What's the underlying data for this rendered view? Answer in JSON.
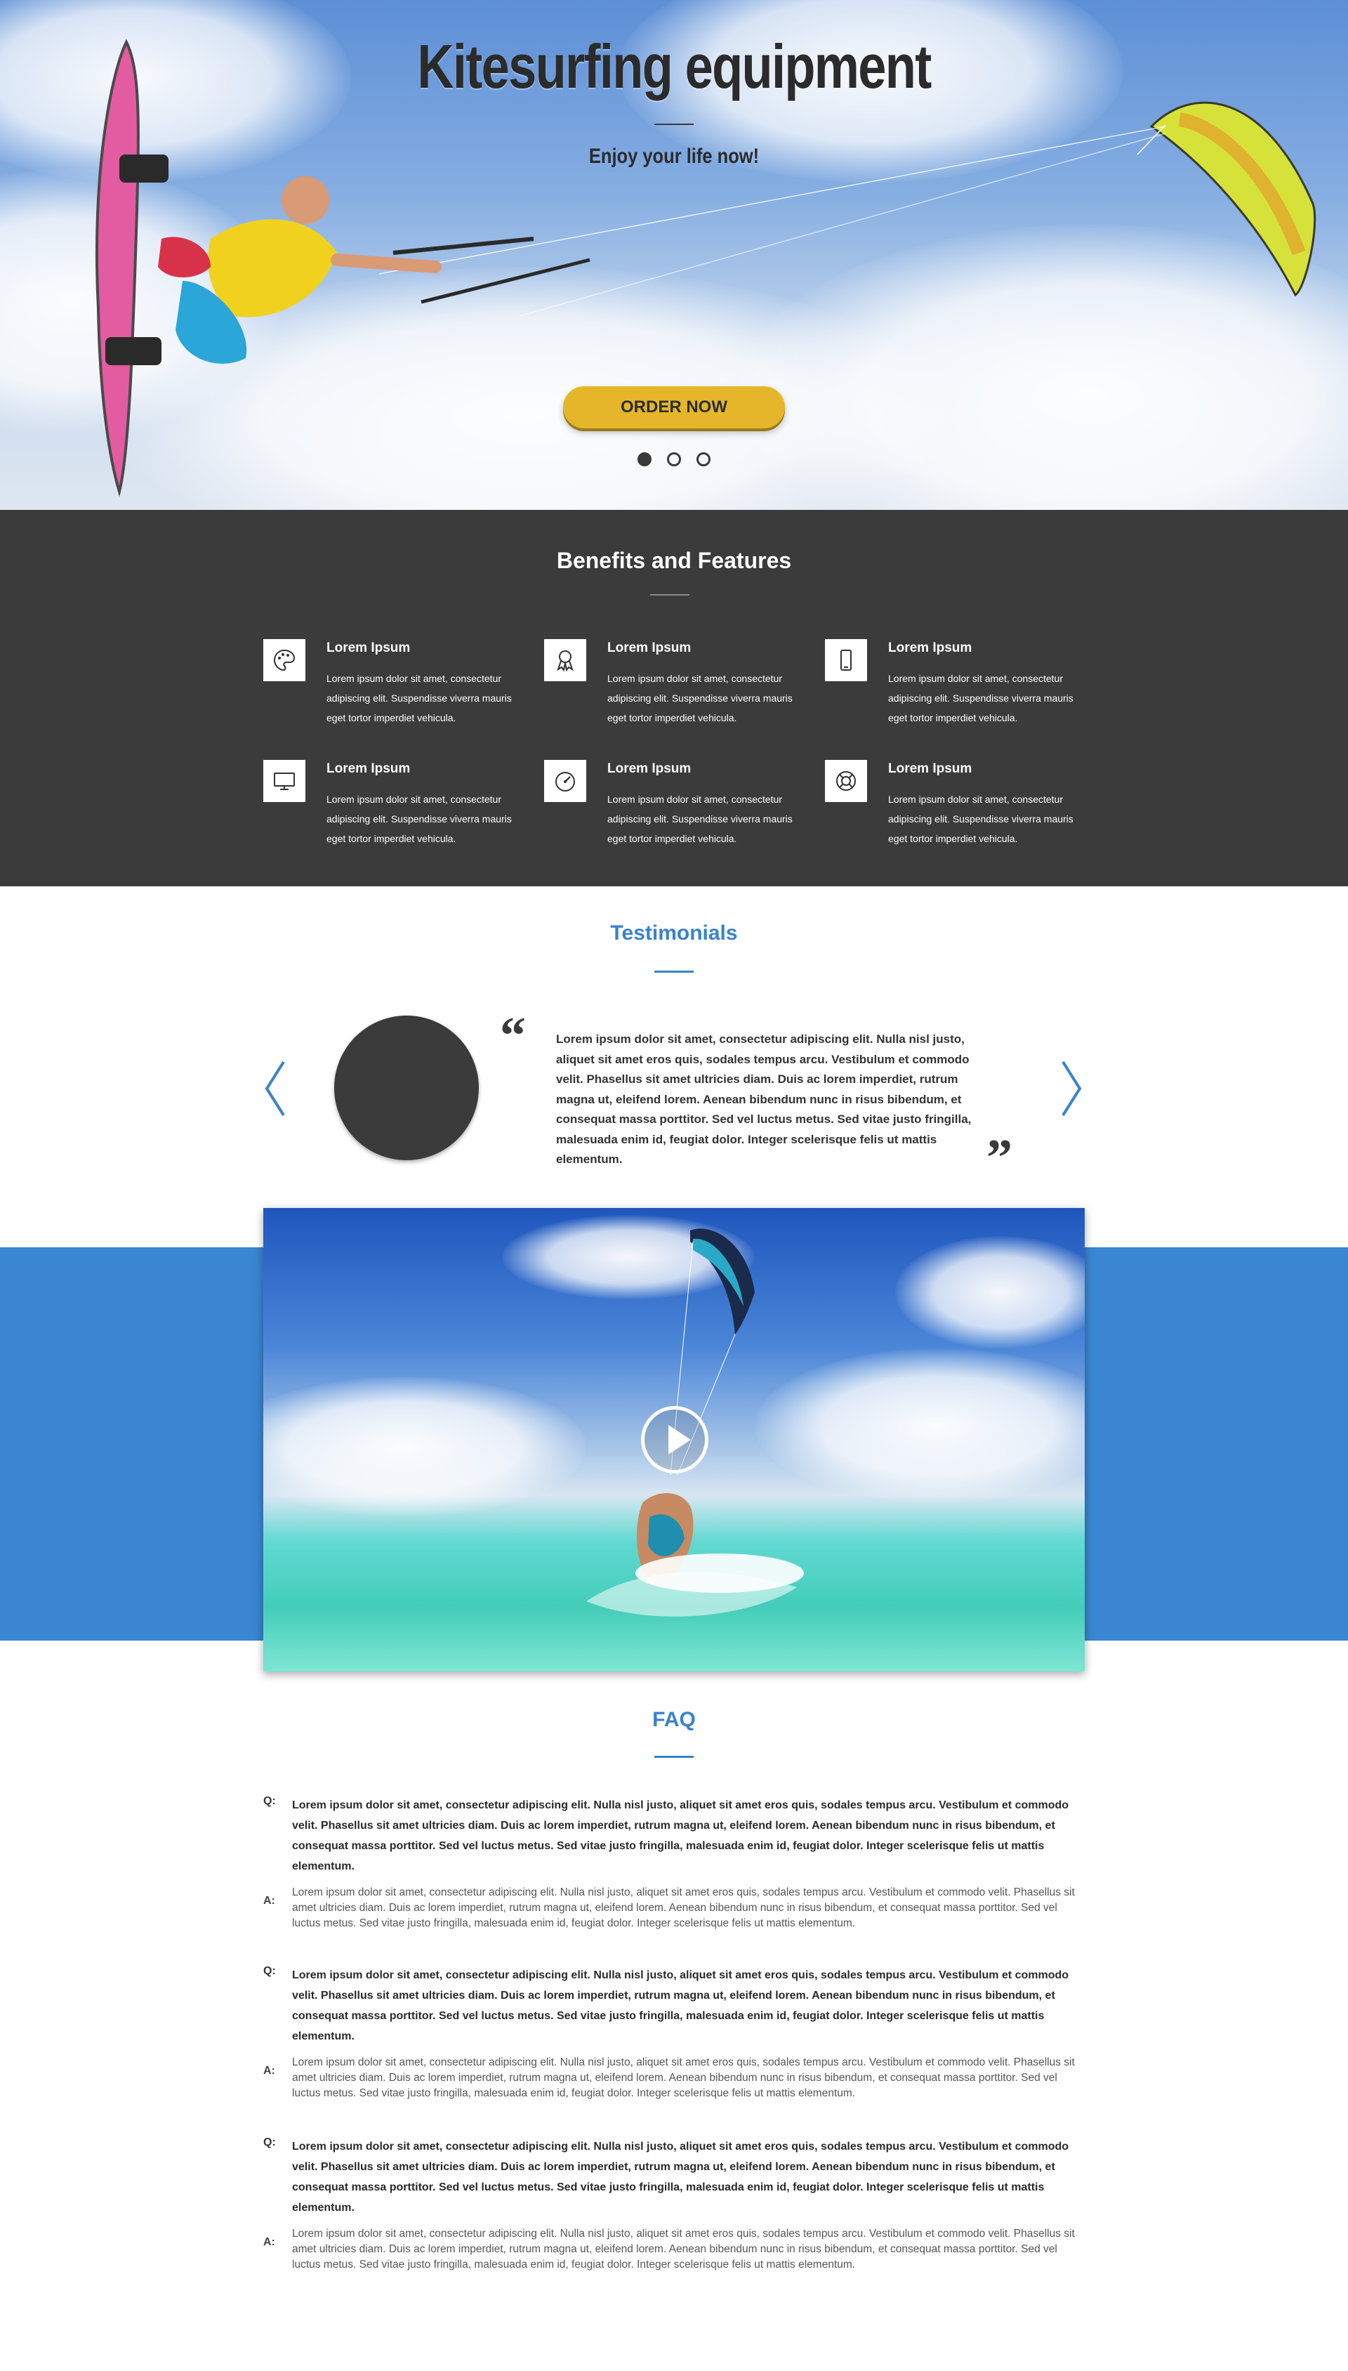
{
  "hero": {
    "title": "Kitesurfing equipment",
    "subtitle": "Enjoy your life now!",
    "cta_label": "ORDER NOW",
    "slides_count": 3,
    "active_slide": 1
  },
  "benefits": {
    "title": "Benefits and Features",
    "features": [
      {
        "icon": "palette-icon",
        "title": "Lorem Ipsum",
        "text": "Lorem ipsum dolor sit amet, consectetur adipiscing elit. Suspendisse viverra mauris eget tortor imperdiet vehicula."
      },
      {
        "icon": "award-icon",
        "title": "Lorem Ipsum",
        "text": "Lorem ipsum dolor sit amet, consectetur adipiscing elit. Suspendisse viverra mauris eget tortor imperdiet vehicula."
      },
      {
        "icon": "mobile-icon",
        "title": "Lorem Ipsum",
        "text": "Lorem ipsum dolor sit amet, consectetur adipiscing elit. Suspendisse viverra mauris eget tortor imperdiet vehicula."
      },
      {
        "icon": "monitor-icon",
        "title": "Lorem Ipsum",
        "text": "Lorem ipsum dolor sit amet, consectetur adipiscing elit. Suspendisse viverra mauris eget tortor imperdiet vehicula."
      },
      {
        "icon": "speedometer-icon",
        "title": "Lorem Ipsum",
        "text": "Lorem ipsum dolor sit amet, consectetur adipiscing elit. Suspendisse viverra mauris eget tortor imperdiet vehicula."
      },
      {
        "icon": "lifebuoy-icon",
        "title": "Lorem Ipsum",
        "text": "Lorem ipsum dolor sit amet, consectetur adipiscing elit. Suspendisse viverra mauris eget tortor imperdiet vehicula."
      }
    ]
  },
  "testimonials": {
    "title": "Testimonials",
    "quote": "Lorem ipsum dolor sit amet, consectetur adipiscing elit. Nulla nisl justo, aliquet sit amet eros quis, sodales tempus arcu. Vestibulum et commodo velit. Phasellus sit amet ultricies diam. Duis ac lorem imperdiet, rutrum magna ut, eleifend lorem. Aenean bibendum nunc in risus bibendum, et consequat massa porttitor. Sed vel luctus metus. Sed vitae justo fringilla, malesuada enim id, feugiat dolor. Integer scelerisque felis ut mattis elementum.",
    "open_quote": "“",
    "close_quote": "”"
  },
  "faq": {
    "title": "FAQ",
    "q_letter": "Q:",
    "a_letter": "A:",
    "items": [
      {
        "q": "Lorem ipsum dolor sit amet, consectetur adipiscing elit. Nulla nisl justo, aliquet sit amet eros quis, sodales tempus arcu. Vestibulum et commodo velit. Phasellus sit amet ultricies diam. Duis ac lorem imperdiet, rutrum magna ut, eleifend lorem. Aenean bibendum nunc in risus bibendum, et consequat massa porttitor. Sed vel luctus metus. Sed vitae justo fringilla, malesuada enim id, feugiat dolor. Integer scelerisque felis ut mattis elementum.",
        "a": "Lorem ipsum dolor sit amet, consectetur adipiscing elit. Nulla nisl justo, aliquet sit amet eros quis, sodales tempus arcu. Vestibulum et commodo velit. Phasellus sit amet ultricies diam. Duis ac lorem imperdiet, rutrum magna ut, eleifend lorem. Aenean bibendum nunc in risus bibendum, et consequat massa porttitor. Sed vel luctus metus. Sed vitae justo fringilla, malesuada enim id, feugiat dolor. Integer scelerisque felis ut mattis elementum."
      },
      {
        "q": "Lorem ipsum dolor sit amet, consectetur adipiscing elit. Nulla nisl justo, aliquet sit amet eros quis, sodales tempus arcu. Vestibulum et commodo velit. Phasellus sit amet ultricies diam. Duis ac lorem imperdiet, rutrum magna ut, eleifend lorem. Aenean bibendum nunc in risus bibendum, et consequat massa porttitor. Sed vel luctus metus. Sed vitae justo fringilla, malesuada enim id, feugiat dolor. Integer scelerisque felis ut mattis elementum.",
        "a": "Lorem ipsum dolor sit amet, consectetur adipiscing elit. Nulla nisl justo, aliquet sit amet eros quis, sodales tempus arcu. Vestibulum et commodo velit. Phasellus sit amet ultricies diam. Duis ac lorem imperdiet, rutrum magna ut, eleifend lorem. Aenean bibendum nunc in risus bibendum, et consequat massa porttitor. Sed vel luctus metus. Sed vitae justo fringilla, malesuada enim id, feugiat dolor. Integer scelerisque felis ut mattis elementum."
      },
      {
        "q": "Lorem ipsum dolor sit amet, consectetur adipiscing elit. Nulla nisl justo, aliquet sit amet eros quis, sodales tempus arcu. Vestibulum et commodo velit. Phasellus sit amet ultricies diam. Duis ac lorem imperdiet, rutrum magna ut, eleifend lorem. Aenean bibendum nunc in risus bibendum, et consequat massa porttitor. Sed vel luctus metus. Sed vitae justo fringilla, malesuada enim id, feugiat dolor. Integer scelerisque felis ut mattis elementum.",
        "a": "Lorem ipsum dolor sit amet, consectetur adipiscing elit. Nulla nisl justo, aliquet sit amet eros quis, sodales tempus arcu. Vestibulum et commodo velit. Phasellus sit amet ultricies diam. Duis ac lorem imperdiet, rutrum magna ut, eleifend lorem. Aenean bibendum nunc in risus bibendum, et consequat massa porttitor. Sed vel luctus metus. Sed vitae justo fringilla, malesuada enim id, feugiat dolor. Integer scelerisque felis ut mattis elementum."
      }
    ]
  },
  "colors": {
    "accent_blue": "#3a82cc",
    "band_blue": "#3a86d2",
    "dark_section": "#3b3b3b",
    "cta_yellow": "#e5b62a"
  }
}
